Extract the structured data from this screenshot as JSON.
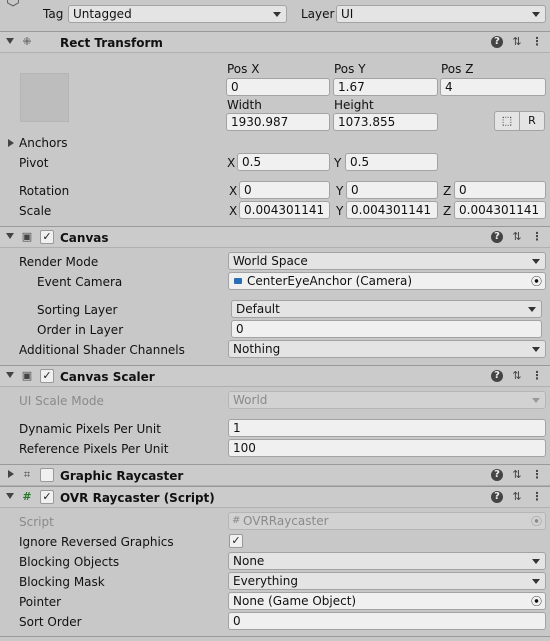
{
  "top": {
    "tag_label": "Tag",
    "tag_value": "Untagged",
    "layer_label": "Layer",
    "layer_value": "UI"
  },
  "rect_transform": {
    "title": "Rect Transform",
    "pos_x_label": "Pos X",
    "pos_y_label": "Pos Y",
    "pos_z_label": "Pos Z",
    "pos_x": "0",
    "pos_y": "1.67",
    "pos_z": "4",
    "width_label": "Width",
    "height_label": "Height",
    "width": "1930.987",
    "height": "1073.855",
    "r_button": "R",
    "anchors_label": "Anchors",
    "pivot_label": "Pivot",
    "pivot_x": "0.5",
    "pivot_y": "0.5",
    "rotation_label": "Rotation",
    "rot_x": "0",
    "rot_y": "0",
    "rot_z": "0",
    "scale_label": "Scale",
    "scale_x": "0.004301141",
    "scale_y": "0.004301141",
    "scale_z": "0.004301141",
    "x": "X",
    "y": "Y",
    "z": "Z"
  },
  "canvas": {
    "title": "Canvas",
    "enabled": true,
    "render_mode_label": "Render Mode",
    "render_mode": "World Space",
    "event_camera_label": "Event Camera",
    "event_camera": "CenterEyeAnchor (Camera)",
    "sorting_layer_label": "Sorting Layer",
    "sorting_layer": "Default",
    "order_label": "Order in Layer",
    "order": "0",
    "shader_label": "Additional Shader Channels",
    "shader": "Nothing"
  },
  "canvas_scaler": {
    "title": "Canvas Scaler",
    "enabled": true,
    "ui_scale_label": "UI Scale Mode",
    "ui_scale": "World",
    "dynamic_label": "Dynamic Pixels Per Unit",
    "dynamic": "1",
    "reference_label": "Reference Pixels Per Unit",
    "reference": "100"
  },
  "graphic_raycaster": {
    "title": "Graphic Raycaster",
    "enabled": false
  },
  "ovr_raycaster": {
    "title": "OVR Raycaster (Script)",
    "enabled": true,
    "script_label": "Script",
    "script": "OVRRaycaster",
    "ignore_label": "Ignore Reversed Graphics",
    "ignore_checked": true,
    "blocking_objects_label": "Blocking Objects",
    "blocking_objects": "None",
    "blocking_mask_label": "Blocking Mask",
    "blocking_mask": "Everything",
    "pointer_label": "Pointer",
    "pointer": "None (Game Object)",
    "sort_order_label": "Sort Order",
    "sort_order": "0"
  },
  "icons": {
    "help": "help-icon",
    "presets": "presets-icon",
    "menu": "kebab-menu-icon",
    "gameobject": "gameobject-icon",
    "recttransform": "rect-transform-icon",
    "canvas": "canvas-icon",
    "camera": "camera-icon",
    "raycaster": "raycaster-icon",
    "script": "script-icon",
    "picker": "object-picker-icon"
  }
}
